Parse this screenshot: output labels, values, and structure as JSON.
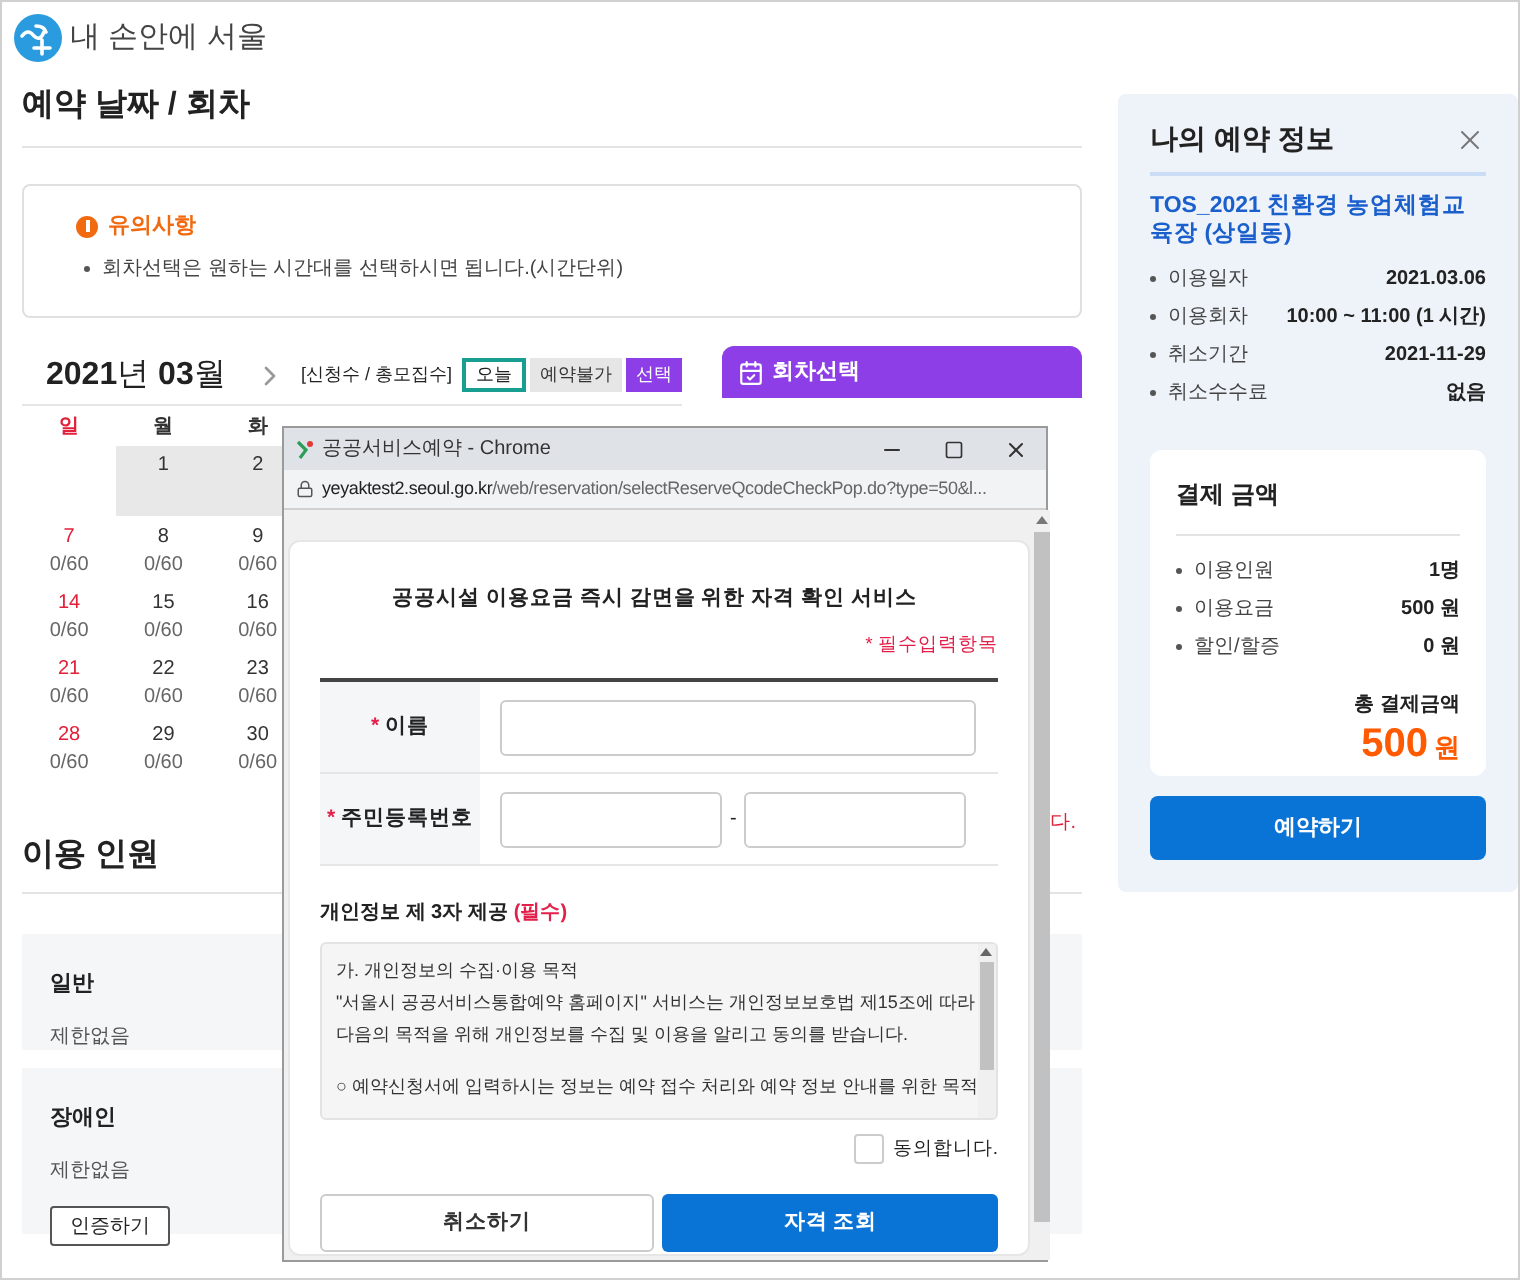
{
  "header": {
    "logo_text": "내 손안에 서울"
  },
  "main": {
    "title": "예약 날짜 / 회차",
    "notice": {
      "title": "유의사항",
      "items": [
        "회차선택은 원하는 시간대를 선택하시면 됩니다.(시간단위)"
      ]
    },
    "calendar": {
      "year": "2021",
      "year_unit": "년",
      "month": "03",
      "month_unit": "월",
      "legend_note": "[신청수 / 총모집수]",
      "legend": [
        {
          "label": "오늘",
          "kind": "today"
        },
        {
          "label": "예약불가",
          "kind": "unavailable"
        },
        {
          "label": "선택",
          "kind": "selected"
        }
      ],
      "weekdays": [
        {
          "label": "일",
          "kind": "sunday"
        },
        {
          "label": "월",
          "kind": "weekday"
        },
        {
          "label": "화",
          "kind": "weekday"
        }
      ],
      "weeks": [
        [
          {
            "kind": "blank"
          },
          {
            "date": "1",
            "kind": "unavailable"
          },
          {
            "date": "2",
            "kind": "unavailable"
          }
        ],
        [
          {
            "date": "7",
            "count": "0/60",
            "kind": "sunday"
          },
          {
            "date": "8",
            "count": "0/60",
            "kind": "normal"
          },
          {
            "date": "9",
            "count": "0/60",
            "kind": "normal"
          }
        ],
        [
          {
            "date": "14",
            "count": "0/60",
            "kind": "sunday"
          },
          {
            "date": "15",
            "count": "0/60",
            "kind": "normal"
          },
          {
            "date": "16",
            "count": "0/60",
            "kind": "normal"
          }
        ],
        [
          {
            "date": "21",
            "count": "0/60",
            "kind": "sunday"
          },
          {
            "date": "22",
            "count": "0/60",
            "kind": "normal"
          },
          {
            "date": "23",
            "count": "0/60",
            "kind": "normal"
          }
        ],
        [
          {
            "date": "28",
            "count": "0/60",
            "kind": "sunday"
          },
          {
            "date": "29",
            "count": "0/60",
            "kind": "normal"
          },
          {
            "date": "30",
            "count": "0/60",
            "kind": "normal"
          }
        ]
      ]
    },
    "session_panel": {
      "title": "회차선택",
      "cut_text": "다."
    },
    "people": {
      "title": "이용 인원",
      "groups": [
        {
          "name": "일반",
          "limit": "제한없음"
        },
        {
          "name": "장애인",
          "limit": "제한없음",
          "button": "인증하기"
        }
      ]
    }
  },
  "reservation_panel": {
    "title": "나의 예약 정보",
    "facility": "TOS_2021 친환경 농업체험교육장 (상일동)",
    "details": [
      {
        "label": "이용일자",
        "value": "2021.03.06"
      },
      {
        "label": "이용회차",
        "value": "10:00 ~ 11:00 (1 시간)"
      },
      {
        "label": "취소기간",
        "value": "2021-11-29"
      },
      {
        "label": "취소수수료",
        "value": "없음"
      }
    ],
    "payment": {
      "title": "결제 금액",
      "rows": [
        {
          "label": "이용인원",
          "value": "1명"
        },
        {
          "label": "이용요금",
          "value": "500 원"
        },
        {
          "label": "할인/할증",
          "value": "0 원"
        }
      ],
      "total_label": "총 결제금액",
      "total_amount": "500",
      "total_unit": "원"
    },
    "button": "예약하기"
  },
  "popup": {
    "window_title": "공공서비스예약 - Chrome",
    "url_host": "yeyaktest2.seoul.go.kr",
    "url_path": "/web/reservation/selectReserveQcodeCheckPop.do?type=50&l...",
    "heading": "공공시설 이용요금 즉시 감면을 위한 자격 확인 서비스",
    "required_note": "* 필수입력항목",
    "fields": [
      {
        "mark": "*",
        "label": "이름",
        "kind": "single"
      },
      {
        "mark": "*",
        "label": "주민등록번호",
        "kind": "split",
        "separator": "-"
      }
    ],
    "consent_title": "개인정보 제 3자 제공",
    "consent_required": "(필수)",
    "consent_lines": [
      "가. 개인정보의 수집·이용 목적",
      "\"서울시 공공서비스통합예약 홈페이지\" 서비스는 개인정보보호법 제15조에 따라",
      "다음의 목적을 위해 개인정보를 수집 및 이용을 알리고 동의를 받습니다.",
      "○ 예약신청서에 입력하시는 정보는 예약 접수 처리와 예약 정보 안내를 위한 목적"
    ],
    "agree": {
      "label": "동의합니다.",
      "checked": false
    },
    "buttons": [
      {
        "label": "취소하기",
        "kind": "secondary"
      },
      {
        "label": "자격 조회",
        "kind": "primary"
      }
    ]
  }
}
